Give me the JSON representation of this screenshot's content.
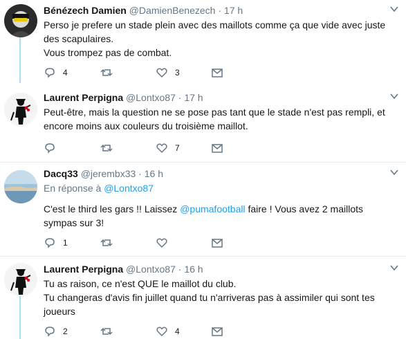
{
  "tweets": [
    {
      "name": "Bénézech Damien",
      "handle": "@DamienBenezech",
      "dot": "·",
      "time": "17 h",
      "text_lines": [
        "Perso je prefere un stade plein avec des maillots comme ça que vide avec juste des scapulaires.",
        "Vous trompez pas de combat."
      ],
      "replies": "4",
      "retweets": "",
      "likes": "3"
    },
    {
      "name": "Laurent Perpigna",
      "handle": "@Lontxo87",
      "dot": "·",
      "time": "17 h",
      "text_lines": [
        "Peut-être, mais la question ne se pose pas tant que le stade n'est pas rempli, et encore moins aux couleurs du troisième maillot."
      ],
      "replies": "",
      "retweets": "",
      "likes": "7"
    },
    {
      "name": "Dacq33",
      "handle": "@jerembx33",
      "dot": "·",
      "time": "16 h",
      "reply_prefix": "En réponse à",
      "reply_mention": "@Lontxo87",
      "text_before": "C'est le third les gars !! Laissez ",
      "text_mention": "@pumafootball",
      "text_after": " faire ! Vous avez 2 maillots sympas sur 3!",
      "replies": "1",
      "retweets": "",
      "likes": ""
    },
    {
      "name": "Laurent Perpigna",
      "handle": "@Lontxo87",
      "dot": "·",
      "time": "16 h",
      "text_lines": [
        "Tu as raison, ce n'est QUE le maillot du club.",
        "Tu changeras d'avis fin juillet quand tu n'arriveras pas à assimiler qui sont tes joueurs"
      ],
      "replies": "2",
      "retweets": "",
      "likes": "4"
    }
  ],
  "colors": {
    "accent": "#1da1f2",
    "thread_line": "#a8dbf5",
    "muted": "#657786"
  }
}
